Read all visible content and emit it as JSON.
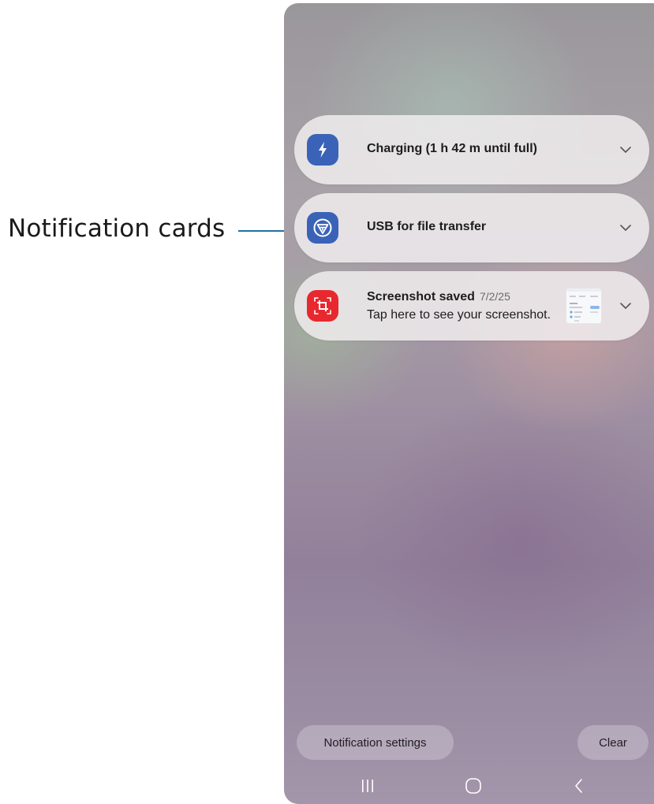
{
  "annotation": {
    "label": "Notification cards"
  },
  "notifications": [
    {
      "icon": "lightning-bolt-icon",
      "icon_bg": "#3a63b8",
      "title": "Charging (1 h 42 m until full)"
    },
    {
      "icon": "usb-icon",
      "icon_bg": "#3a63b8",
      "title": "USB for file transfer"
    },
    {
      "icon": "screenshot-crop-icon",
      "icon_bg": "#e8282f",
      "title": "Screenshot saved",
      "time": "7/2/25",
      "body": "Tap here to see your screenshot.",
      "thumbnail": "screenshot-thumbnail"
    }
  ],
  "footer": {
    "settings_label": "Notification settings",
    "clear_label": "Clear"
  },
  "navigation": {
    "recents": "recents-icon",
    "home": "home-icon",
    "back": "back-icon"
  }
}
